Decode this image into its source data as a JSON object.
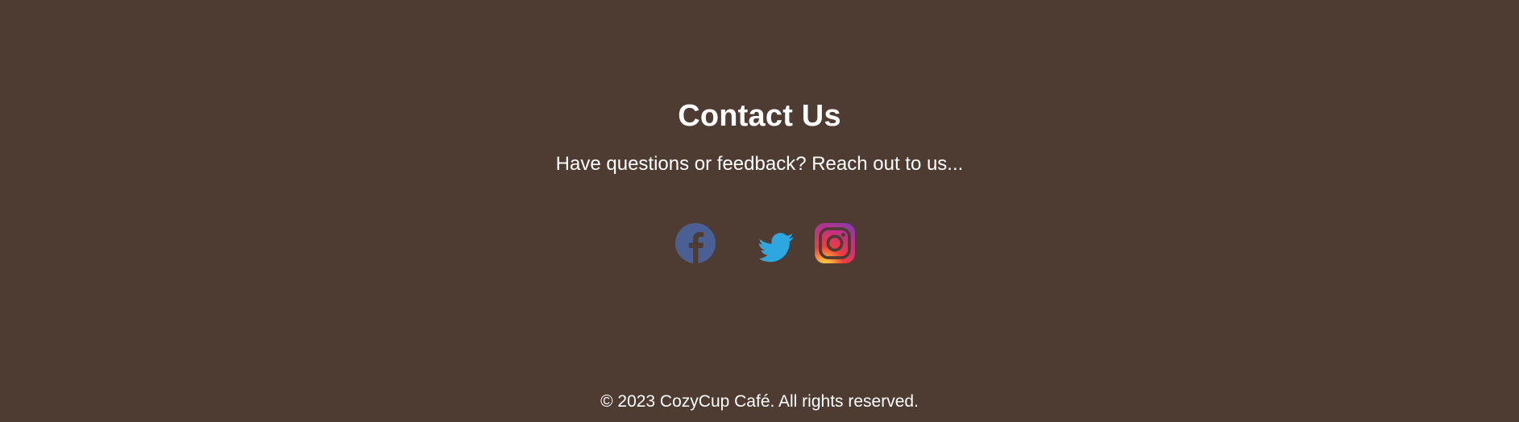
{
  "contact": {
    "title": "Contact Us",
    "subtitle": "Have questions or feedback? Reach out to us..."
  },
  "social": {
    "links": [
      {
        "icon": "facebook-icon",
        "color": "#4a6094"
      },
      {
        "icon": "twitter-icon",
        "color": "#2ea7e0"
      },
      {
        "icon": "instagram-icon",
        "colors": [
          "#f9c846",
          "#ee2a4e",
          "#c13584",
          "#833ab4"
        ]
      }
    ]
  },
  "footer": {
    "copyright": "© 2023 CozyCup Café. All rights reserved."
  },
  "colors": {
    "background": "#4e3c33",
    "text": "#ffffff"
  }
}
